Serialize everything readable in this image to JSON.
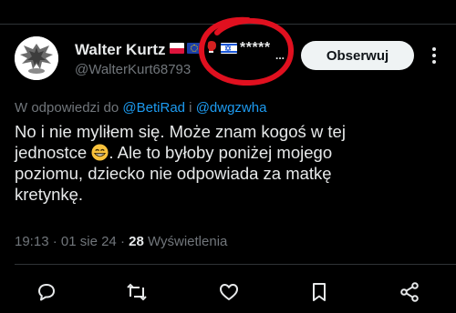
{
  "author": {
    "display_name": "Walter Kurtz",
    "name_suffix_text": "*****",
    "name_suffix_ellipsis": "...",
    "handle": "@WalterKurt68793"
  },
  "follow_button": {
    "label": "Obserwuj"
  },
  "reply_context": {
    "prefix": "W odpowiedzi do",
    "user1": "@BetiRad",
    "conjunction": "i",
    "user2": "@dwgzwha"
  },
  "tweet": {
    "line1": "No i nie myliłem się. Może znam kogoś w tej",
    "line2_before_emoji": "jednostce",
    "line2_after_emoji": ". Ale to byłoby poniżej mojego",
    "line3": "poziomu, dziecko nie odpowiada za matkę",
    "line4": "kretynkę."
  },
  "meta": {
    "time": "19:13",
    "separator": "·",
    "date": "01 sie 24",
    "views_count": "28",
    "views_label": "Wyświetlenia"
  },
  "icons": {
    "reply": "reply-icon",
    "retweet": "retweet-icon",
    "like": "heart-icon",
    "bookmark": "bookmark-icon",
    "share": "share-icon",
    "more": "more-vertical-icon"
  },
  "colors": {
    "background": "#000000",
    "text_primary": "#e7e9ea",
    "text_secondary": "#71767b",
    "link": "#1d9bf0",
    "annotation": "#e0101f"
  }
}
